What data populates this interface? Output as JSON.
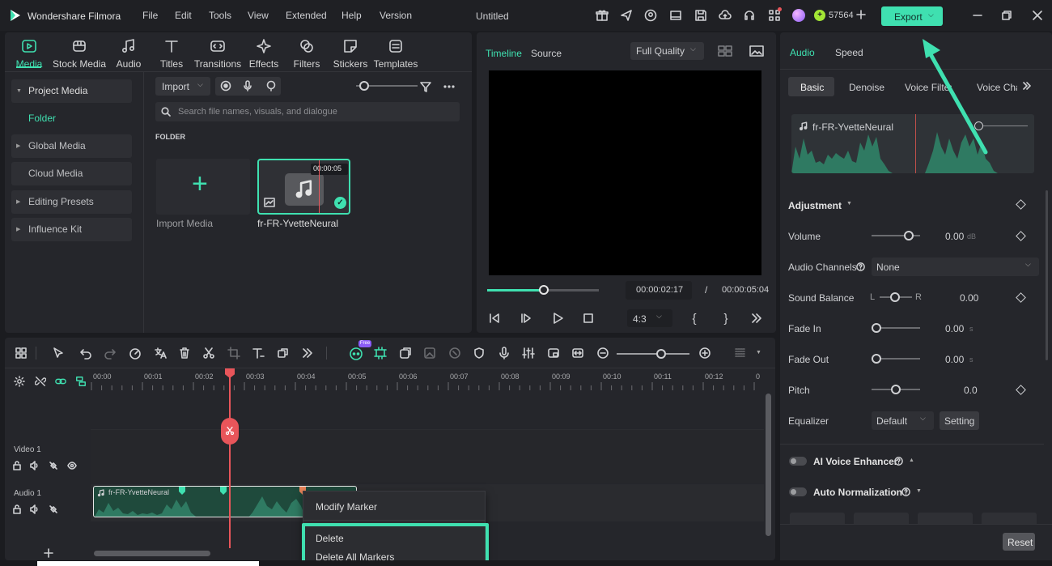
{
  "app": {
    "name": "Wondershare Filmora",
    "menu": [
      "File",
      "Edit",
      "Tools",
      "View",
      "Extended",
      "Help",
      "Version"
    ],
    "doc_title": "Untitled",
    "credits": "57564",
    "export_label": "Export"
  },
  "media_tabs": [
    "Media",
    "Stock Media",
    "Audio",
    "Titles",
    "Transitions",
    "Effects",
    "Filters",
    "Stickers",
    "Templates"
  ],
  "sidebar": {
    "items": [
      {
        "label": "Project Media"
      },
      {
        "label": "Folder"
      },
      {
        "label": "Global Media"
      },
      {
        "label": "Cloud Media"
      },
      {
        "label": "Editing Presets"
      },
      {
        "label": "Influence Kit"
      }
    ]
  },
  "library": {
    "import_label": "Import",
    "search_placeholder": "Search file names, visuals, and dialogue",
    "folder_heading": "FOLDER",
    "import_media_label": "Import Media",
    "clip_name": "fr-FR-YvetteNeural",
    "clip_duration": "00:00:05"
  },
  "player": {
    "tab_timeline": "Timeline",
    "tab_source": "Source",
    "quality": "Full Quality",
    "current_time": "00:00:02:17",
    "separator": "/",
    "total_time": "00:00:05:04",
    "aspect": "4:3",
    "progress": 0.51
  },
  "properties": {
    "tabs": [
      "Audio",
      "Speed"
    ],
    "subtabs": [
      "Basic",
      "Denoise",
      "Voice Filters",
      "Voice Cha"
    ],
    "clip_name": "fr-FR-YvetteNeural",
    "adjustment_label": "Adjustment",
    "volume_label": "Volume",
    "volume_value": "0.00",
    "volume_unit": "dB",
    "audio_channels_label": "Audio Channels",
    "audio_channels_value": "None",
    "sound_balance_label": "Sound Balance",
    "balance_l": "L",
    "balance_r": "R",
    "sound_balance_value": "0.00",
    "fade_in_label": "Fade In",
    "fade_in_value": "0.00",
    "fade_out_label": "Fade Out",
    "fade_out_value": "0.00",
    "sec_unit": "s",
    "pitch_label": "Pitch",
    "pitch_value": "0.0",
    "equalizer_label": "Equalizer",
    "equalizer_value": "Default",
    "setting_label": "Setting",
    "ai_voice_label": "AI Voice Enhancer",
    "auto_norm_label": "Auto Normalization",
    "reset_label": "Reset"
  },
  "timeline": {
    "ticks": [
      "00:00",
      "00:01",
      "00:02",
      "00:03",
      "00:04",
      "00:05",
      "00:06",
      "00:07",
      "00:08",
      "00:09",
      "00:10",
      "00:11",
      "00:12",
      "0"
    ],
    "free_badge": "Free",
    "video_track": "Video 1",
    "audio_track": "Audio 1",
    "clip_name": "fr-FR-YvetteNeural"
  },
  "context_menu": {
    "items": [
      "Modify Marker",
      "Delete",
      "Delete All Markers"
    ]
  },
  "colors": {
    "accent": "#3fe0b0",
    "playhead": "#e8555a",
    "panel": "#25262b",
    "waveform": "#2f7a62"
  }
}
